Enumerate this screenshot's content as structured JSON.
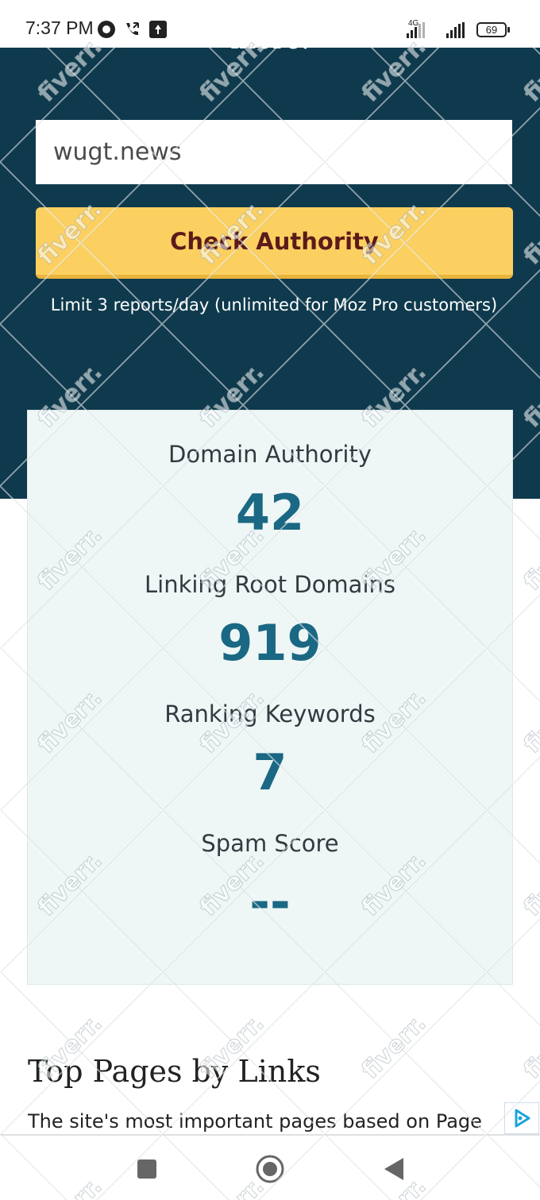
{
  "status_bar": {
    "time": "7:37 PM",
    "network": "4G",
    "battery": "69",
    "icons": [
      "whatsapp-icon",
      "call-forward-icon",
      "upload-icon",
      "signal-icon",
      "battery-icon"
    ]
  },
  "hero": {
    "cut_text": "more.",
    "domain_value": "wugt.news",
    "check_button_label": "Check Authority",
    "limit_text": "Limit 3 reports/day (unlimited for Moz Pro customers)"
  },
  "metrics": [
    {
      "label": "Domain Authority",
      "value": "42"
    },
    {
      "label": "Linking Root Domains",
      "value": "919"
    },
    {
      "label": "Ranking Keywords",
      "value": "7"
    },
    {
      "label": "Spam Score",
      "value": "--"
    }
  ],
  "section": {
    "title": "Top Pages by Links",
    "description": "The site's most important pages based on Page"
  },
  "watermark": {
    "text": "fiverr."
  },
  "colors": {
    "hero_bg": "#0f3a4d",
    "button_bg": "#fcd060",
    "button_text": "#5c1a1a",
    "card_bg": "#eef6f6",
    "metric_value": "#1a6883",
    "ad_icon": "#1aa3d9"
  },
  "nav_bar": {
    "icons": [
      "recent-apps-icon",
      "home-icon",
      "back-icon"
    ]
  }
}
